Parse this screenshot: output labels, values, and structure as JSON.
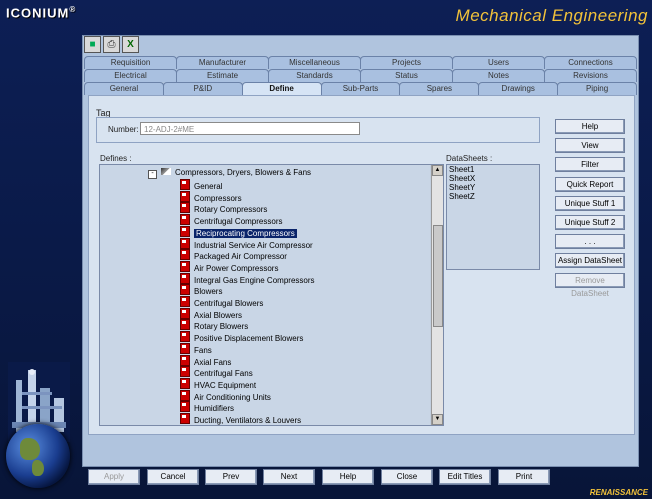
{
  "app": {
    "brand": "ICONIUM",
    "brand_mark": "®",
    "banner": "Mechanical Engineering",
    "footer": "RENAISSANCE"
  },
  "toolbar": {
    "icons": [
      "chart-icon",
      "print-icon",
      "excel-icon"
    ]
  },
  "tabs": {
    "row1": [
      "Requisition",
      "Manufacturer",
      "Miscellaneous",
      "Projects",
      "Users",
      "Connections"
    ],
    "row2": [
      "Electrical",
      "Estimate",
      "Standards",
      "Status",
      "Notes",
      "Revisions"
    ],
    "row3": [
      "General",
      "P&ID",
      "Define",
      "Sub-Parts",
      "Spares",
      "Drawings",
      "Piping"
    ],
    "active": "Define"
  },
  "tag": {
    "section_label": "Tag",
    "number_label": "Number:",
    "number_value": "12-ADJ-2#ME"
  },
  "defines": {
    "label": "Defines :",
    "root": "Compressors, Dryers, Blowers & Fans",
    "items": [
      "General",
      "Compressors",
      "Rotary Compressors",
      "Centrifugal Compressors",
      "Reciprocating Compressors",
      "Industrial Service Air Compressor",
      "Packaged Air Compressor",
      "Air Power Compressors",
      "Integral Gas Engine Compressors",
      "Blowers",
      "Centrifugal Blowers",
      "Axial Blowers",
      "Rotary  Blowers",
      "Positive Displacement Blowers",
      "Fans",
      "Axial Fans",
      "Centrifugal Fans",
      "HVAC  Equipment",
      "Air Conditioning Units",
      "Humidifiers",
      "Ducting, Ventilators & Louvers"
    ],
    "selected": "Reciprocating Compressors"
  },
  "datasheets": {
    "label": "DataSheets :",
    "items": [
      "Sheet1",
      "SheetX",
      "SheetY",
      "SheetZ"
    ]
  },
  "side_buttons": [
    {
      "label": "Help",
      "enabled": true
    },
    {
      "label": "View",
      "enabled": true
    },
    {
      "label": "Filter",
      "enabled": true
    },
    {
      "label": "Quick Report",
      "enabled": true
    },
    {
      "label": "Unique Stuff 1",
      "enabled": true
    },
    {
      "label": "Unique Stuff 2",
      "enabled": true
    },
    {
      "label": ". . .",
      "enabled": true
    },
    {
      "label": "Assign DataSheet",
      "enabled": true
    },
    {
      "label": "Remove DataSheet",
      "enabled": false
    }
  ],
  "bottom_buttons": [
    {
      "label": "Apply",
      "enabled": false
    },
    {
      "label": "Cancel",
      "enabled": true
    },
    {
      "label": "Prev",
      "enabled": true
    },
    {
      "label": "Next",
      "enabled": true
    },
    {
      "label": "Help",
      "enabled": true
    },
    {
      "label": "Close",
      "enabled": true
    },
    {
      "label": "Edit Titles",
      "enabled": true
    },
    {
      "label": "Print",
      "enabled": true
    }
  ]
}
